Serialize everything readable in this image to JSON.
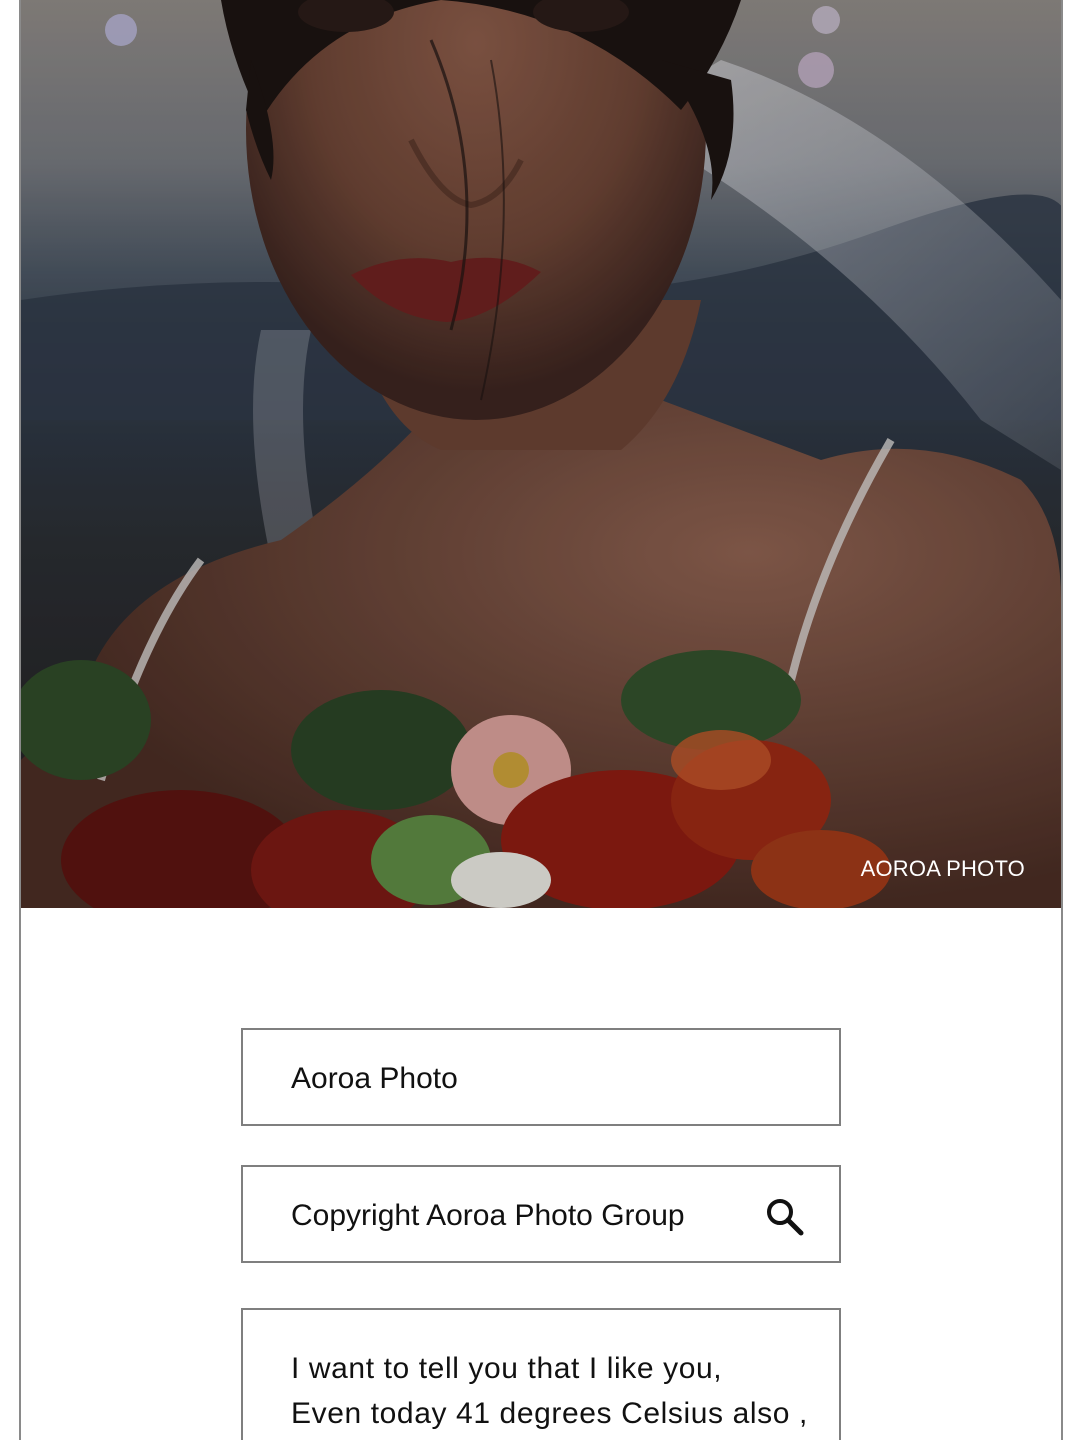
{
  "hero": {
    "watermark": "AOROA PHOTO"
  },
  "form": {
    "field1_value": "Aoroa Photo",
    "field2_value": "Copyright Aoroa Photo Group",
    "search_icon": "search-icon",
    "textarea_lines": [
      "I want to tell you that I like you,",
      "Even today 41 degrees Celsius also ,"
    ]
  }
}
